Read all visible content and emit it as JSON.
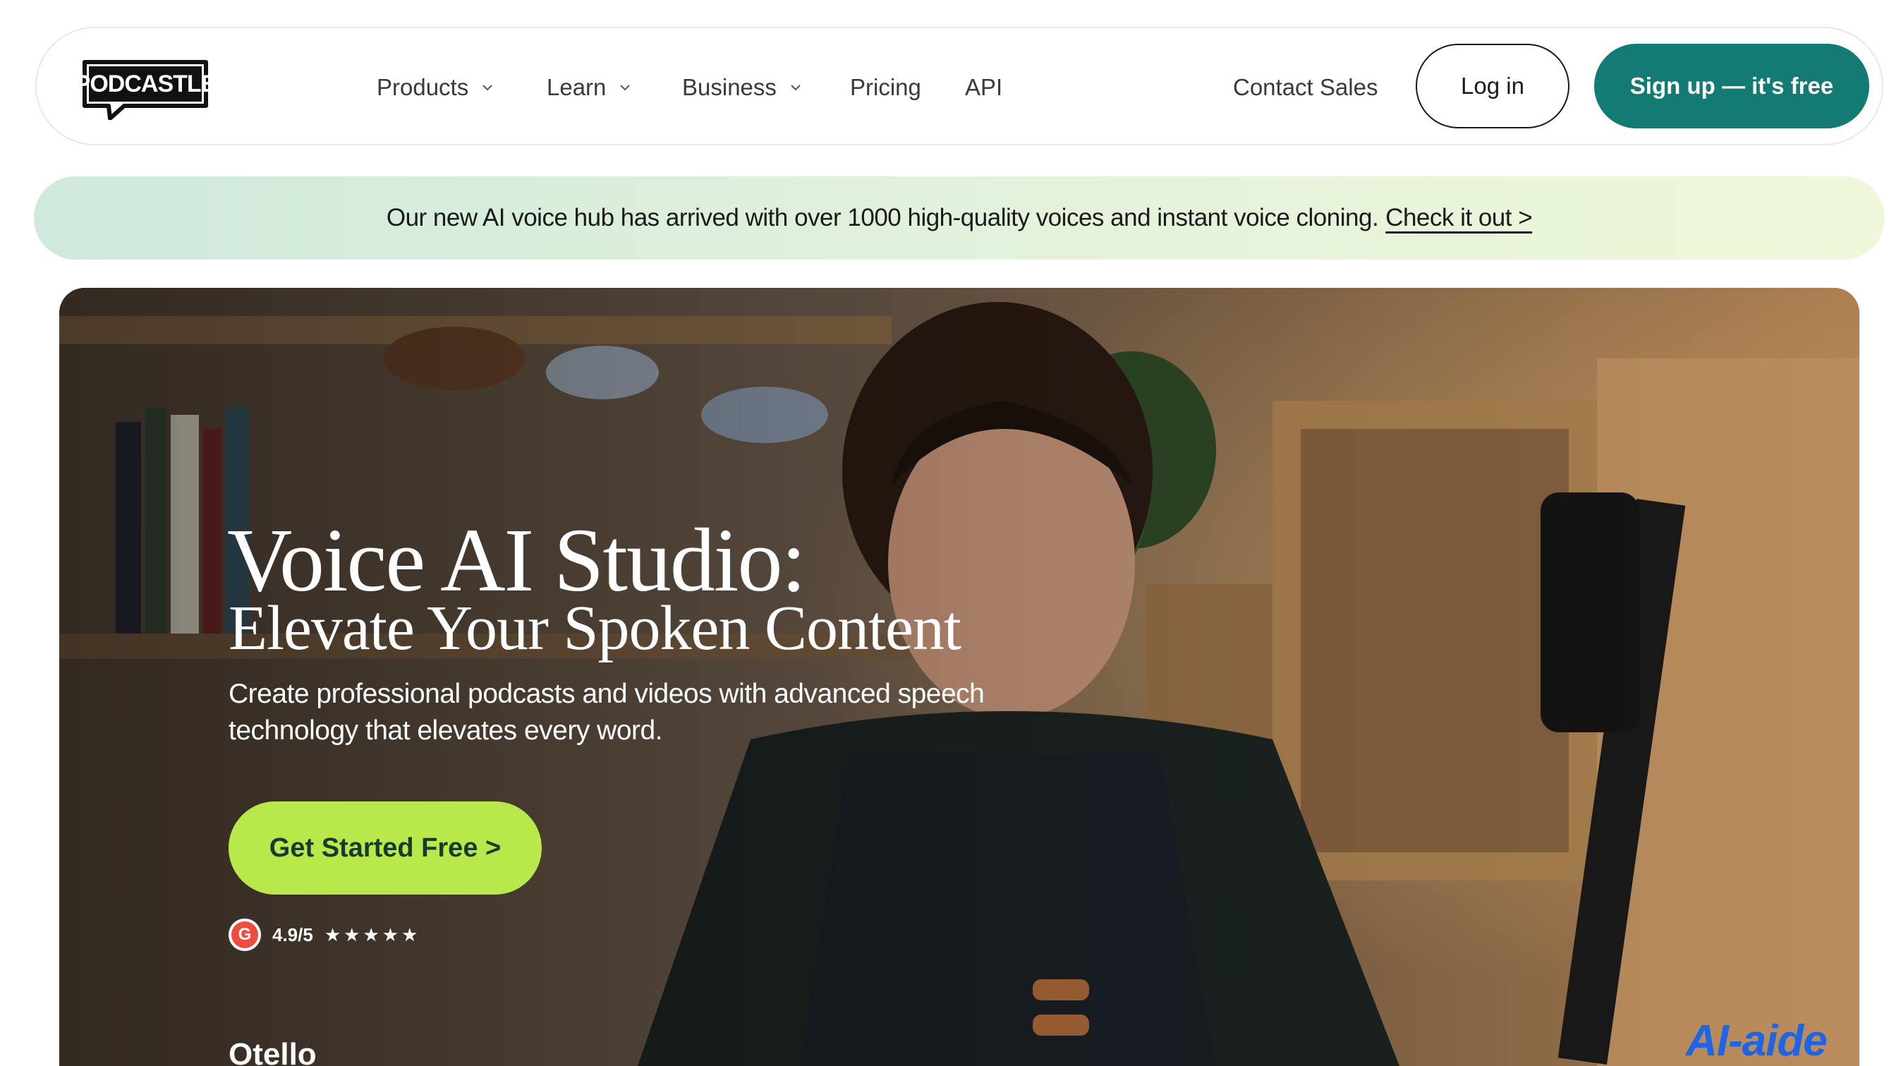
{
  "nav": {
    "logo_text": "PODCASTLE",
    "items": [
      {
        "label": "Products",
        "has_dropdown": true
      },
      {
        "label": "Learn",
        "has_dropdown": true
      },
      {
        "label": "Business",
        "has_dropdown": true
      },
      {
        "label": "Pricing",
        "has_dropdown": false
      },
      {
        "label": "API",
        "has_dropdown": false
      }
    ],
    "contact_sales": "Contact Sales",
    "login": "Log in",
    "signup": "Sign up — it's free"
  },
  "announcement": {
    "text": "Our new AI voice hub has arrived with over 1000 high-quality voices and instant voice cloning.",
    "link": "Check it out >"
  },
  "hero": {
    "title": "Voice AI Studio:",
    "subtitle": "Elevate Your Spoken Content",
    "description": "Create professional podcasts and videos with advanced speech technology that elevates every word.",
    "cta": "Get Started Free >",
    "rating_badge": "G",
    "rating": "4.9/5",
    "stars": "★★★★★",
    "next_section_peek": "Otello"
  },
  "watermark": "AI-aide",
  "colors": {
    "signup_bg": "#137a74",
    "cta_bg": "#b8e84a",
    "announcement_gradient": [
      "#cfe9dc",
      "#eef8d8"
    ],
    "g2_red": "#ef4b3e",
    "watermark_blue": "#1e64e6"
  },
  "icons": [
    "chevron-down-icon",
    "g2-logo-icon",
    "star-icon"
  ]
}
